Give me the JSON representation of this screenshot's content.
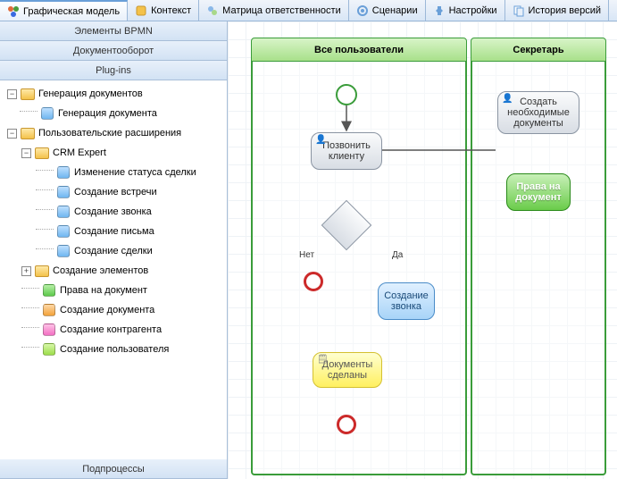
{
  "tabs": [
    {
      "label": "Графическая модель"
    },
    {
      "label": "Контекст"
    },
    {
      "label": "Матрица ответственности"
    },
    {
      "label": "Сценарии"
    },
    {
      "label": "Настройки"
    },
    {
      "label": "История версий"
    }
  ],
  "sidebar": {
    "panels": {
      "bpmn": "Элементы BPMN",
      "docflow": "Документооборот",
      "plugins": "Plug-ins",
      "subprocesses": "Подпроцессы"
    },
    "tree": {
      "gen_docs": "Генерация документов",
      "gen_doc": "Генерация документа",
      "user_ext": "Пользовательские расширения",
      "crm_expert": "CRM Expert",
      "change_status": "Изменение статуса сделки",
      "create_meeting": "Создание встречи",
      "create_call": "Создание звонка",
      "create_letter": "Создание письма",
      "create_deal": "Создание сделки",
      "create_elements": "Создание элементов",
      "rights_doc": "Права на документ",
      "create_document": "Создание документа",
      "create_counterparty": "Создание контрагента",
      "create_user": "Создание пользователя"
    }
  },
  "diagram": {
    "lanes": {
      "all_users": "Все пользователи",
      "secretary": "Секретарь"
    },
    "nodes": {
      "call_client": "Позвонить клиенту",
      "create_docs": "Создать необходимые документы",
      "rights_doc": "Права на документ",
      "create_call": "Создание звонка",
      "docs_done": "Документы сделаны"
    },
    "labels": {
      "no": "Нет",
      "yes": "Да"
    }
  }
}
